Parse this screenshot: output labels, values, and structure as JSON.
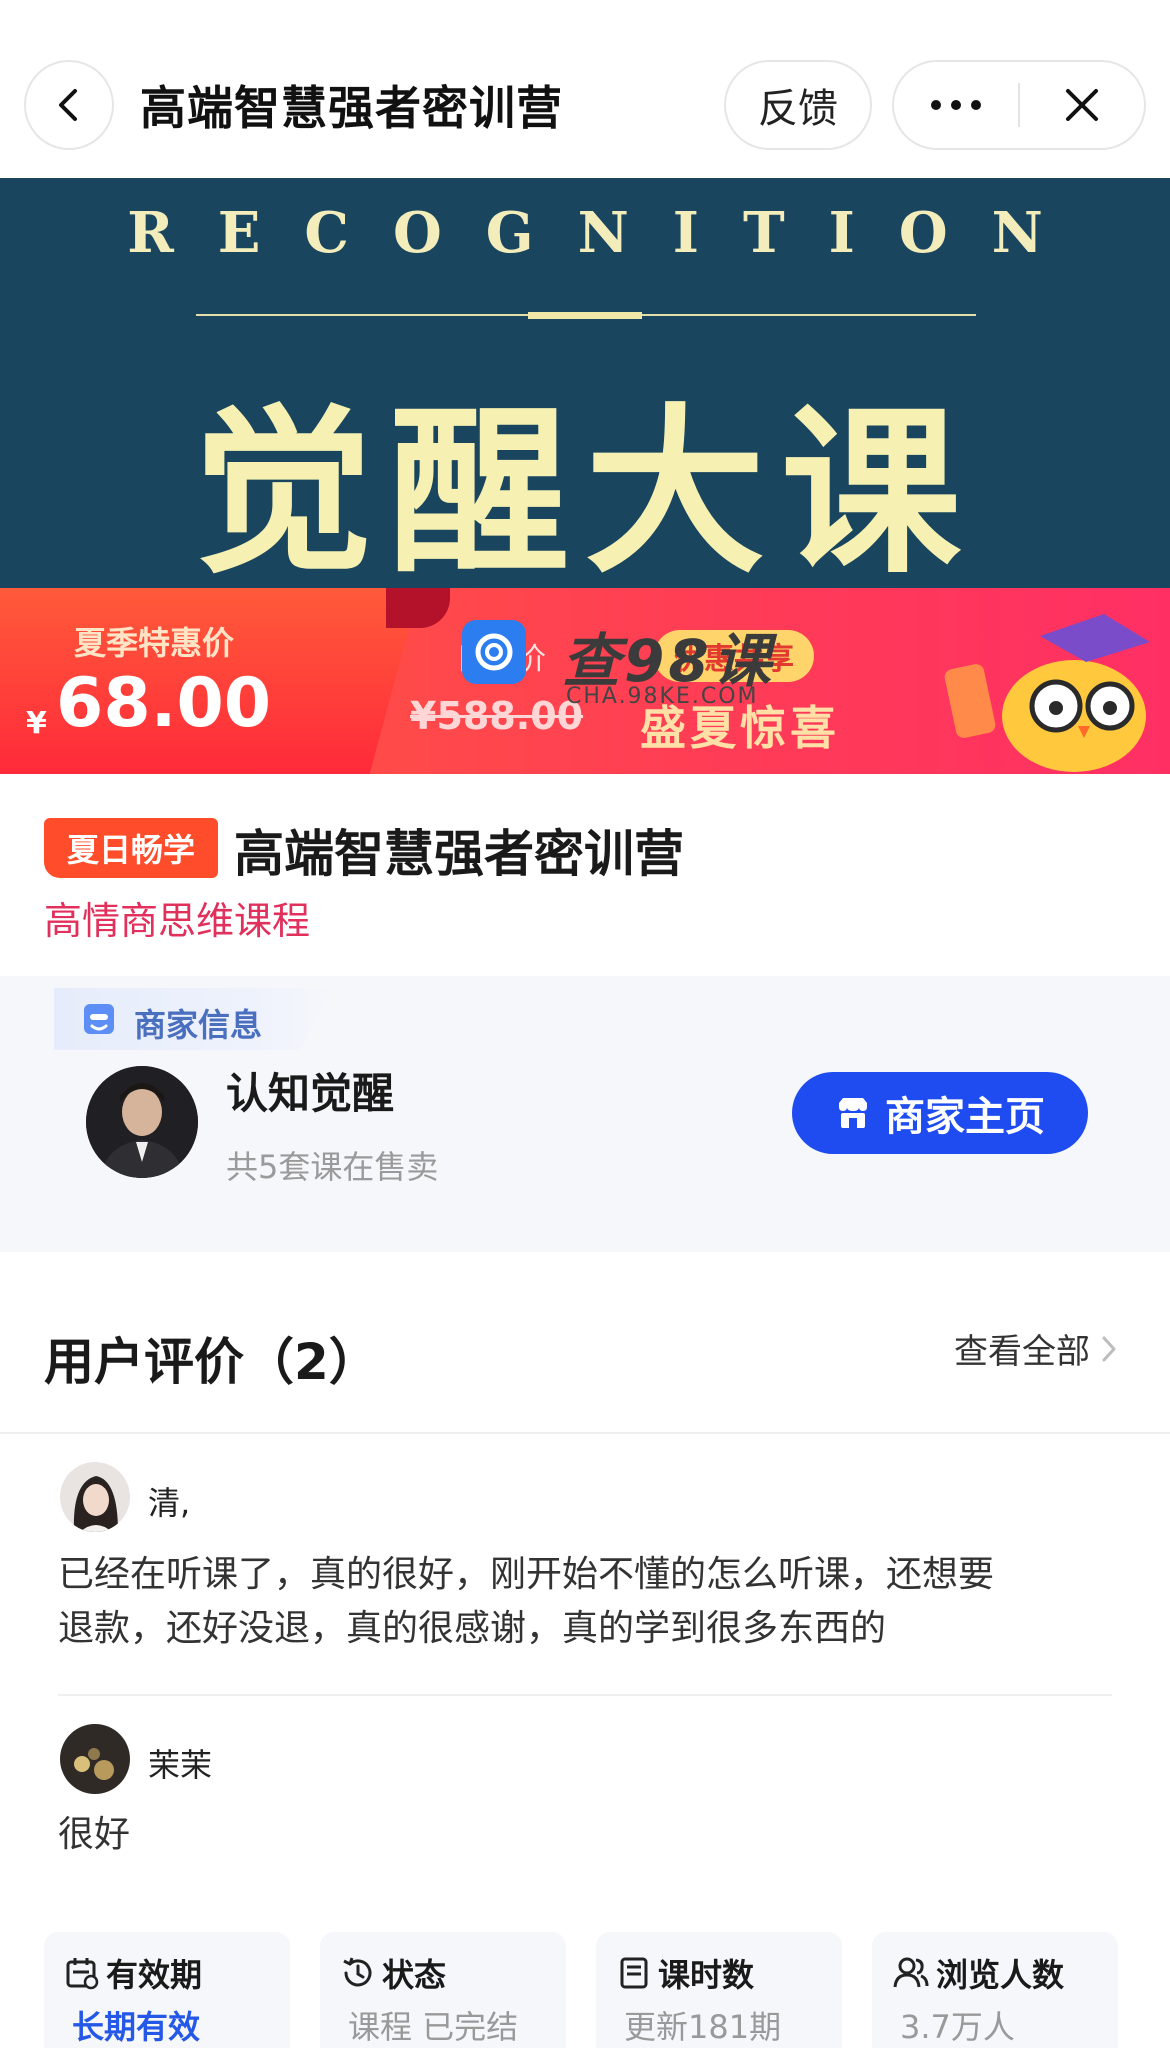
{
  "nav": {
    "title": "高端智慧强者密训营",
    "feedback_label": "反馈",
    "more_icon": "ellipsis-icon",
    "close_icon": "close-icon",
    "back_icon": "chevron-left-icon"
  },
  "banner": {
    "english_title": "RECOGNITION",
    "chinese_title": "觉醒大课",
    "promo_label": "夏季特惠价",
    "currency": "¥",
    "promo_price": "68.00",
    "original_label": "日常价",
    "original_price": "¥588.00",
    "enjoy_pill": "优惠共享",
    "summer_text": "盛夏惊喜",
    "colors": {
      "background": "#19455e",
      "title": "#f6f1b2",
      "strip": "#ff3d55"
    }
  },
  "watermark": {
    "text": "查98课",
    "sub": "CHA.98KE.COM"
  },
  "product": {
    "tag": "夏日畅学",
    "title": "高端智慧强者密训营",
    "subtitle": "高情商思维课程"
  },
  "merchant": {
    "section_label": "商家信息",
    "name": "认知觉醒",
    "course_count": "共5套课在售卖",
    "homepage_button": "商家主页",
    "button_color": "#1f4cf0"
  },
  "reviews": {
    "title": "用户评价（2）",
    "view_all": "查看全部",
    "items": [
      {
        "name": "清,",
        "text_line1": "已经在听课了，真的很好，刚开始不懂的怎么听课，还想要",
        "text_line2": "退款，还好没退，真的很感谢，真的学到很多东西的"
      },
      {
        "name": "茉茉",
        "text_line1": "很好",
        "text_line2": ""
      }
    ]
  },
  "info_cards": [
    {
      "icon": "calendar-icon",
      "label": "有效期",
      "value": "长期有效",
      "highlight": true
    },
    {
      "icon": "history-clock-icon",
      "label": "状态",
      "value": "课程 已完结",
      "highlight": false
    },
    {
      "icon": "document-icon",
      "label": "课时数",
      "value": "更新181期",
      "highlight": false
    },
    {
      "icon": "users-icon",
      "label": "浏览人数",
      "value": "3.7万人",
      "highlight": false
    }
  ]
}
